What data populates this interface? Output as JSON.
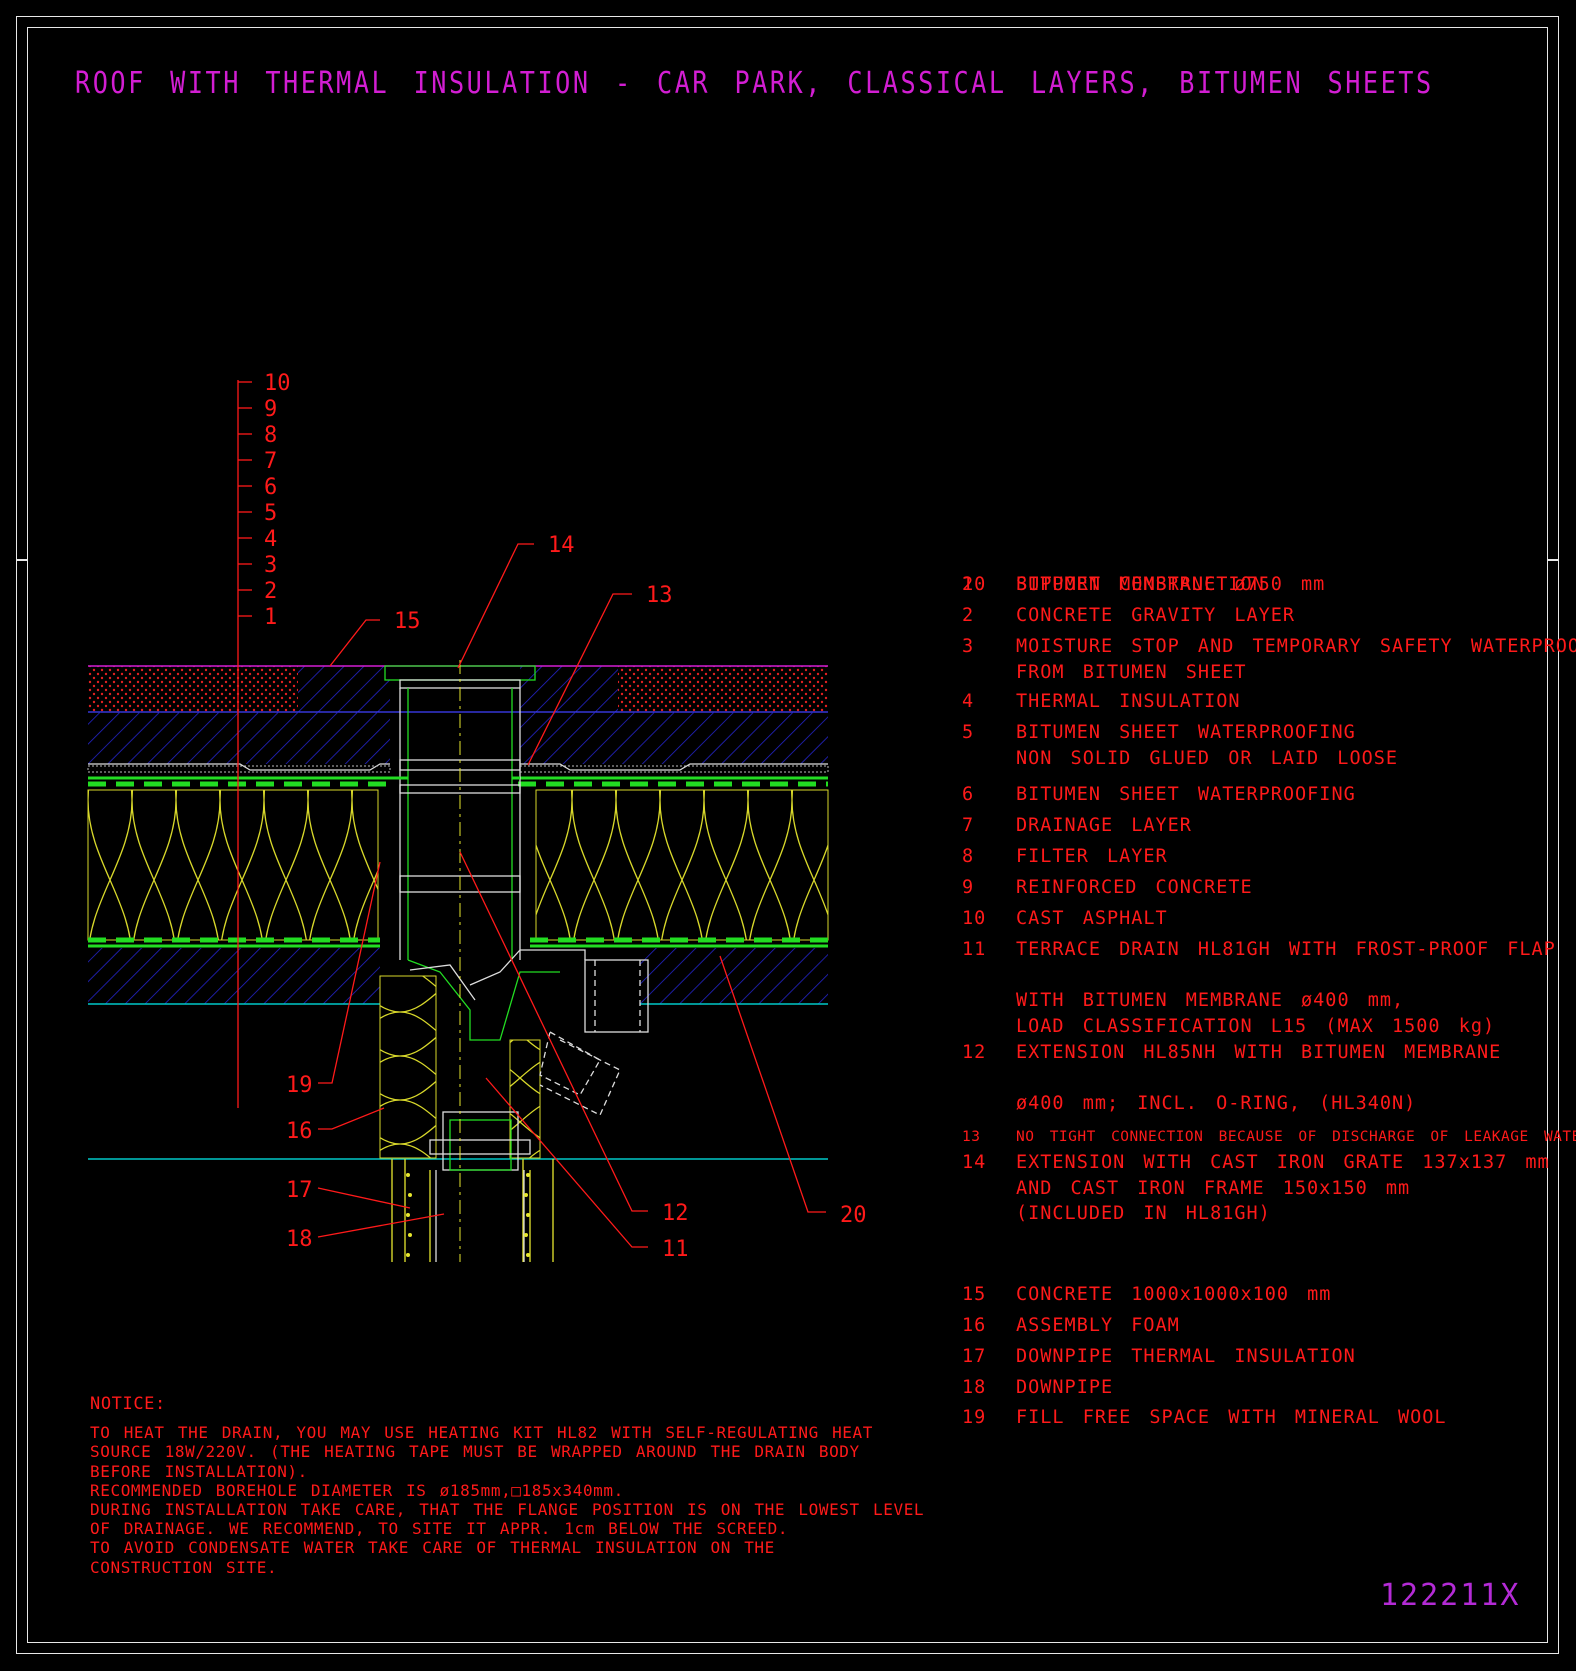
{
  "title": "ROOF WITH THERMAL INSULATION - CAR PARK, CLASSICAL LAYERS, BITUMEN SHEETS",
  "drawing_code": "122211X",
  "layer_scale_numbers": [
    "10",
    "9",
    "8",
    "7",
    "6",
    "5",
    "4",
    "3",
    "2",
    "1"
  ],
  "callout_numbers": [
    "14",
    "13",
    "15",
    "19",
    "16",
    "17",
    "18",
    "12",
    "11",
    "20"
  ],
  "legend": [
    {
      "num": "1",
      "lines": [
        "SUPPORT CONSTRUCTION"
      ]
    },
    {
      "num": "2",
      "lines": [
        "CONCRETE GRAVITY LAYER"
      ]
    },
    {
      "num": "3",
      "lines": [
        "MOISTURE STOP AND TEMPORARY SAFETY WATERPROOFING",
        "FROM BITUMEN SHEET"
      ]
    },
    {
      "num": "4",
      "lines": [
        "THERMAL INSULATION"
      ]
    },
    {
      "num": "5",
      "lines": [
        "BITUMEN SHEET WATERPROOFING",
        "NON SOLID GLUED OR LAID LOOSE"
      ]
    },
    {
      "num": "6",
      "lines": [
        "BITUMEN SHEET WATERPROOFING"
      ]
    },
    {
      "num": "7",
      "lines": [
        "DRAINAGE LAYER"
      ]
    },
    {
      "num": "8",
      "lines": [
        "FILTER LAYER"
      ]
    },
    {
      "num": "9",
      "lines": [
        "REINFORCED CONCRETE"
      ]
    },
    {
      "num": "10",
      "lines": [
        "CAST ASPHALT"
      ]
    },
    {
      "num": "11",
      "lines": [
        "TERRACE DRAIN HL81GH WITH FROST-PROOF FLAP",
        "",
        "WITH BITUMEN MEMBRANE ø400 mm,",
        "LOAD CLASSIFICATION L15 (MAX 1500 kg)"
      ]
    },
    {
      "num": "12",
      "lines": [
        "EXTENSION HL85NH WITH BITUMEN MEMBRANE",
        "",
        "ø400 mm; INCL. O-RING, (HL340N)"
      ]
    },
    {
      "num": "13",
      "lines": [
        "NO TIGHT CONNECTION BECAUSE OF DISCHARGE OF LEAKAGE WATER"
      ]
    },
    {
      "num": "14",
      "lines": [
        "EXTENSION WITH CAST IRON GRATE 137x137 mm",
        "AND CAST IRON FRAME 150x150 mm",
        "(INCLUDED IN HL81GH)"
      ]
    },
    {
      "num": "15",
      "lines": [
        "CONCRETE 1000x1000x100 mm"
      ]
    },
    {
      "num": "16",
      "lines": [
        "ASSEMBLY FOAM"
      ]
    },
    {
      "num": "17",
      "lines": [
        "DOWNPIPE THERMAL INSULATION"
      ]
    },
    {
      "num": "18",
      "lines": [
        "DOWNPIPE"
      ]
    },
    {
      "num": "19",
      "lines": [
        "FILL FREE SPACE WITH MINERAL WOOL"
      ]
    },
    {
      "num": "20",
      "lines": [
        "BITUMEN MEMBRANE ø750 mm"
      ]
    }
  ],
  "notice": {
    "heading": "NOTICE:",
    "lines": [
      "TO HEAT THE DRAIN, YOU MAY USE HEATING KIT HL82 WITH SELF-REGULATING HEAT",
      "SOURCE 18W/220V. (THE HEATING TAPE MUST BE WRAPPED AROUND THE DRAIN BODY",
      "BEFORE INSTALLATION).",
      "RECOMMENDED BOREHOLE DIAMETER IS ø185mm,□185x340mm.",
      "DURING INSTALLATION TAKE CARE, THAT THE FLANGE POSITION IS ON THE LOWEST LEVEL",
      "OF DRAINAGE. WE RECOMMEND, TO SITE IT APPR. 1cm BELOW THE SCREED.",
      "TO AVOID CONDENSATE WATER TAKE CARE OF THERMAL INSULATION ON THE",
      "CONSTRUCTION SITE."
    ]
  },
  "colors": {
    "background": "#000000",
    "title": "#d21ed2",
    "annotation": "#ff1a1a",
    "insulation": "#e6e62e",
    "membrane": "#22dd22",
    "concrete_hatch": "#2424c8",
    "baseline": "#00c8c8",
    "frame": "#e8e8e8"
  }
}
